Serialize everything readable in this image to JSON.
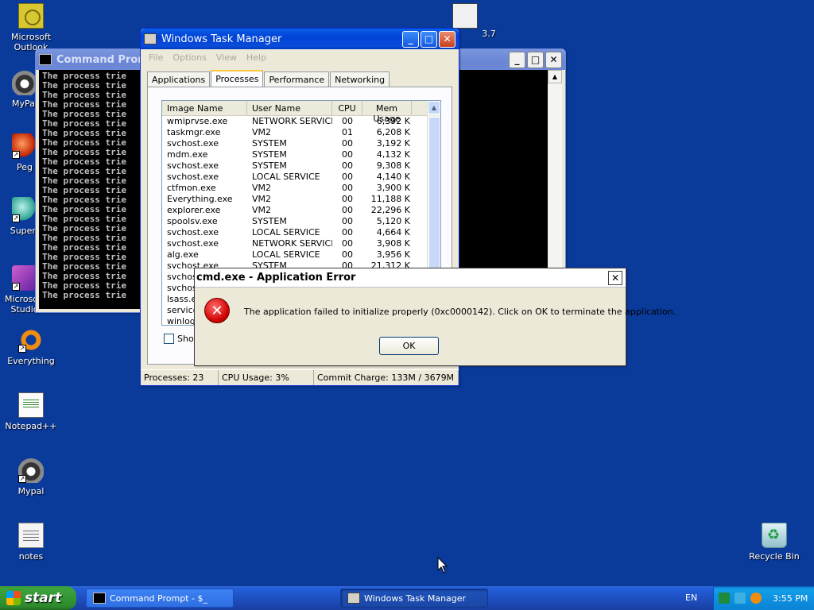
{
  "desktop": {
    "icons": [
      {
        "label": "Microsoft Outlook"
      },
      {
        "label": "MyPal"
      },
      {
        "label": "Peg"
      },
      {
        "label": "Superr"
      },
      {
        "label": "Microsoft Studio"
      },
      {
        "label": "Everything"
      },
      {
        "label": "Notepad++"
      },
      {
        "label": "Mypal"
      },
      {
        "label": "notes"
      },
      {
        "label": "Recycle Bin"
      }
    ],
    "top_icon_label": "3.7"
  },
  "cmd_window": {
    "title": "Command Prompt",
    "line_text": "The process trie",
    "line_count": 24
  },
  "task_manager": {
    "title": "Windows Task Manager",
    "menu": [
      "File",
      "Options",
      "View",
      "Help"
    ],
    "tabs": [
      "Applications",
      "Processes",
      "Performance",
      "Networking"
    ],
    "columns": [
      "Image Name",
      "User Name",
      "CPU",
      "Mem Usage"
    ],
    "rows": [
      [
        "wmiprvse.exe",
        "NETWORK SERVICE",
        "00",
        "6,392 K"
      ],
      [
        "taskmgr.exe",
        "VM2",
        "01",
        "6,208 K"
      ],
      [
        "svchost.exe",
        "SYSTEM",
        "00",
        "3,192 K"
      ],
      [
        "mdm.exe",
        "SYSTEM",
        "00",
        "4,132 K"
      ],
      [
        "svchost.exe",
        "SYSTEM",
        "00",
        "9,308 K"
      ],
      [
        "svchost.exe",
        "LOCAL SERVICE",
        "00",
        "4,140 K"
      ],
      [
        "ctfmon.exe",
        "VM2",
        "00",
        "3,900 K"
      ],
      [
        "Everything.exe",
        "VM2",
        "00",
        "11,188 K"
      ],
      [
        "explorer.exe",
        "VM2",
        "00",
        "22,296 K"
      ],
      [
        "spoolsv.exe",
        "SYSTEM",
        "00",
        "5,120 K"
      ],
      [
        "svchost.exe",
        "LOCAL SERVICE",
        "00",
        "4,664 K"
      ],
      [
        "svchost.exe",
        "NETWORK SERVICE",
        "00",
        "3,908 K"
      ],
      [
        "alg.exe",
        "LOCAL SERVICE",
        "00",
        "3,956 K"
      ],
      [
        "svchost.exe",
        "SYSTEM",
        "00",
        "21,312 K"
      ],
      [
        "svchos",
        "",
        "",
        ""
      ],
      [
        "svchos",
        "",
        "",
        ""
      ],
      [
        "lsass.e",
        "",
        "",
        ""
      ],
      [
        "service",
        "",
        "",
        ""
      ],
      [
        "winlogo",
        "",
        "",
        ""
      ]
    ],
    "show_checkbox_label": "Show",
    "status": {
      "processes": "Processes: 23",
      "cpu": "CPU Usage: 3%",
      "commit": "Commit Charge: 133M / 3679M"
    }
  },
  "error_dialog": {
    "title": "cmd.exe - Application Error",
    "message": "The application failed to initialize properly (0xc0000142). Click on OK to terminate the application.",
    "ok_label": "OK",
    "close_glyph": "✕"
  },
  "taskbar": {
    "start_label": "start",
    "buttons": [
      {
        "label": "Command Prompt - $_"
      },
      {
        "label": "Windows Task Manager"
      }
    ],
    "language": "EN",
    "clock": "3:55 PM"
  },
  "colors": {
    "desktop": "#0a3a9a",
    "title_active": "#0a5fe6",
    "error_icon": "#d00000"
  }
}
